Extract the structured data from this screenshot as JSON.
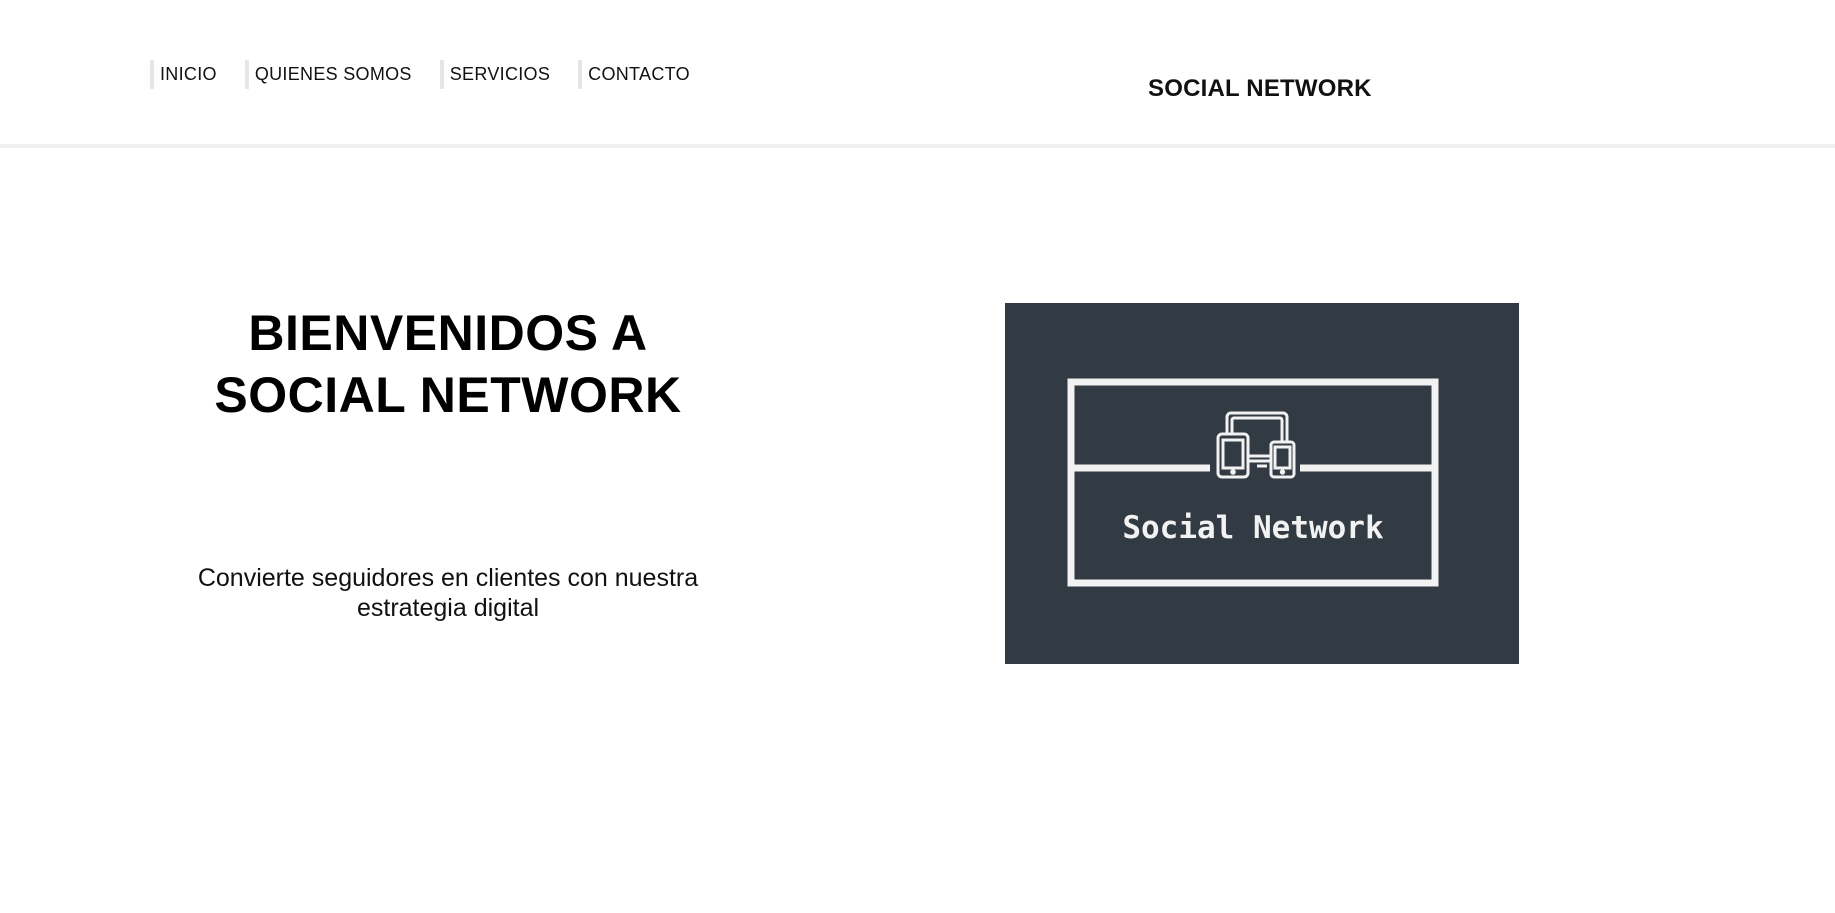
{
  "header": {
    "nav": [
      {
        "label": "INICIO"
      },
      {
        "label": "QUIENES SOMOS"
      },
      {
        "label": "SERVICIOS"
      },
      {
        "label": "CONTACTO"
      }
    ],
    "brand": "SOCIAL NETWORK"
  },
  "hero": {
    "title_line1": "BIENVENIDOS A",
    "title_line2": "SOCIAL NETWORK",
    "subtitle_line1": "Convierte seguidores en clientes con nuestra",
    "subtitle_line2": "estrategia digital"
  },
  "logo": {
    "text": "Social Network",
    "icon": "devices-icon",
    "background_color": "#323a43",
    "line_color": "#f2f2f2"
  }
}
